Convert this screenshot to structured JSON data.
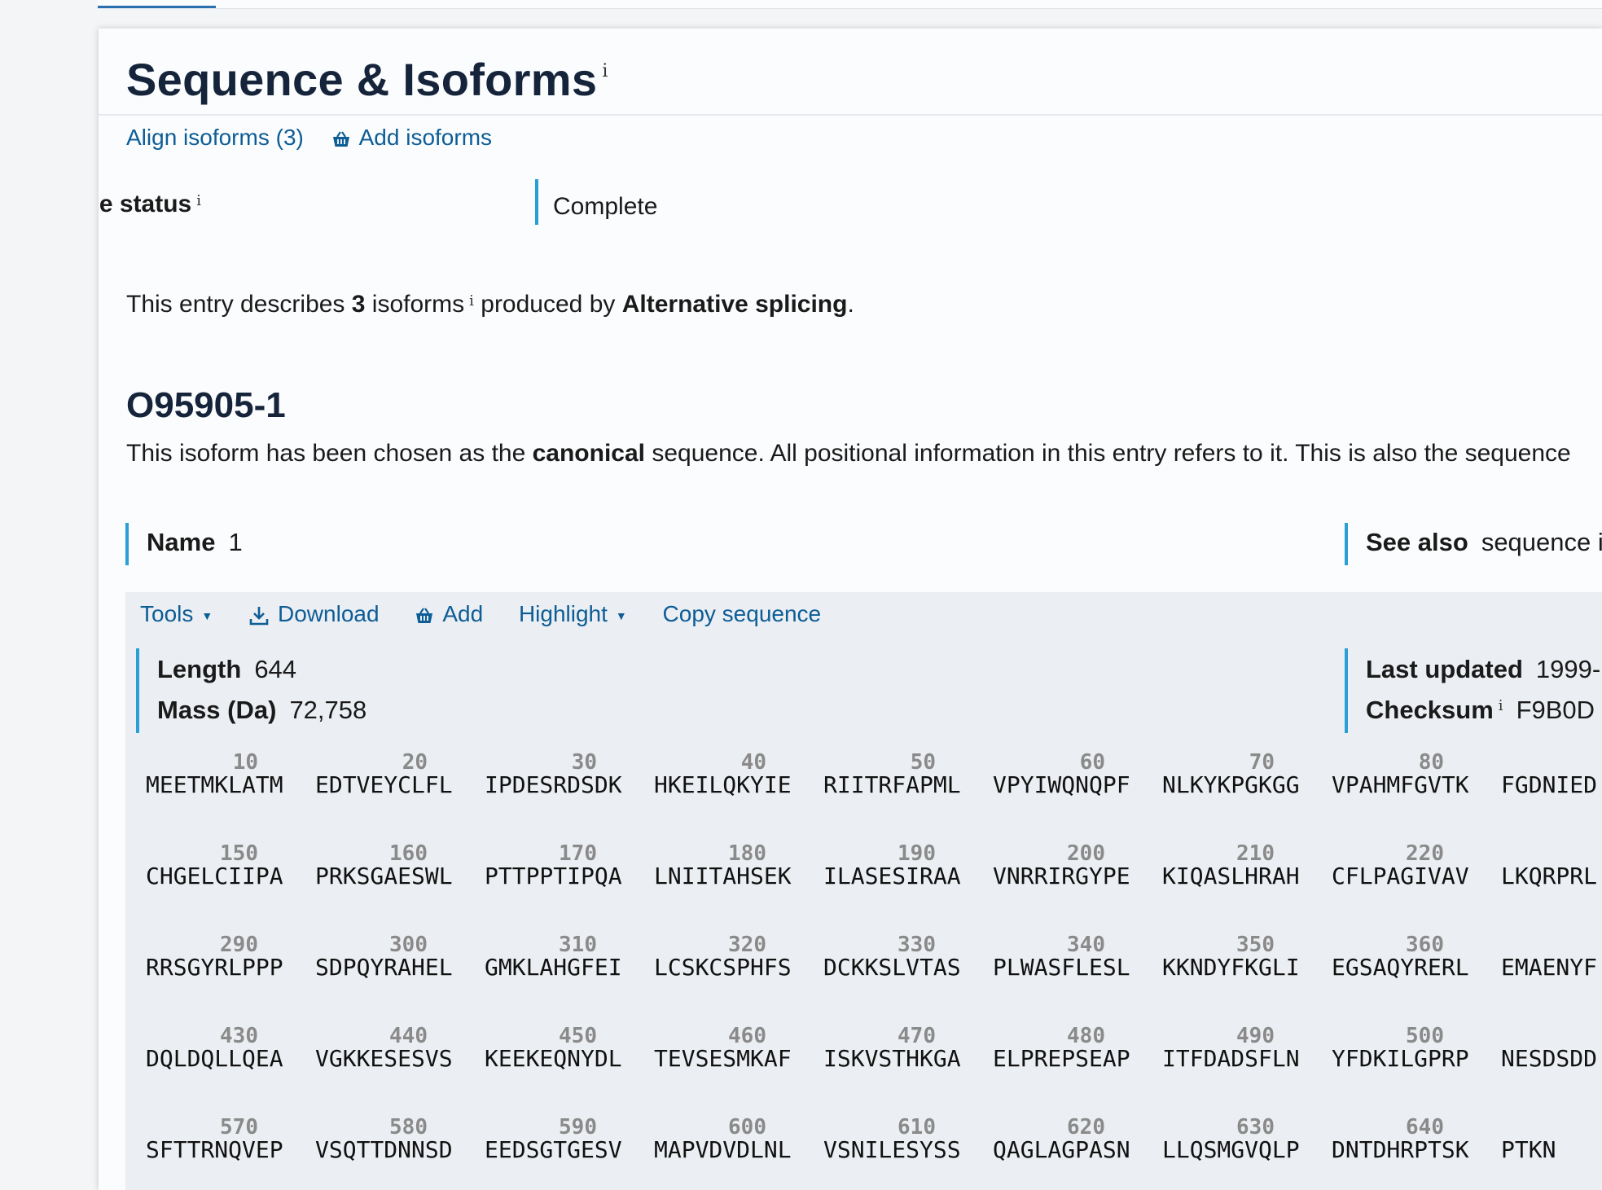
{
  "section": {
    "title": "Sequence & Isoforms",
    "info_marker": "i"
  },
  "links": {
    "align_isoforms": "Align isoforms (3)",
    "add_isoforms": "Add isoforms"
  },
  "sequence_status": {
    "label": "Sequence status",
    "value": "Complete"
  },
  "description": {
    "prefix": "This entry describes ",
    "count": "3",
    "middle": " isoforms",
    "after": " produced by ",
    "mechanism": "Alternative splicing",
    "end": "."
  },
  "isoform": {
    "id": "O95905-1",
    "text_prefix": "This isoform has been chosen as the ",
    "text_bold": "canonical",
    "text_suffix": " sequence. All positional information in this entry refers to it. This is also the sequence",
    "name_label": "Name",
    "name_value": "1",
    "see_also_label": "See also",
    "see_also_value": "sequence i"
  },
  "toolbar": {
    "tools": "Tools",
    "download": "Download",
    "add": "Add",
    "highlight": "Highlight",
    "copy_sequence": "Copy sequence"
  },
  "meta": {
    "length_label": "Length",
    "length_value": "644",
    "mass_label": "Mass (Da)",
    "mass_value": "72,758",
    "last_updated_label": "Last updated",
    "last_updated_value": "1999-",
    "checksum_label": "Checksum",
    "checksum_value": "F9B0D"
  },
  "sequence_rows": [
    [
      {
        "pos": "10",
        "res": "MEETMKLATM"
      },
      {
        "pos": "20",
        "res": "EDTVEYCLFL"
      },
      {
        "pos": "30",
        "res": "IPDESRDSDK"
      },
      {
        "pos": "40",
        "res": "HKEILQKYIE"
      },
      {
        "pos": "50",
        "res": "RIITRFAPML"
      },
      {
        "pos": "60",
        "res": "VPYIWQNQPF"
      },
      {
        "pos": "70",
        "res": "NLKYKPGKGG"
      },
      {
        "pos": "80",
        "res": "VPAHMFGVTK"
      },
      {
        "pos": "",
        "res": "FGDNIED"
      }
    ],
    [
      {
        "pos": "150",
        "res": "CHGELCIIPA"
      },
      {
        "pos": "160",
        "res": "PRKSGAESWL"
      },
      {
        "pos": "170",
        "res": "PTTPPTIPQA"
      },
      {
        "pos": "180",
        "res": "LNIITAHSEK"
      },
      {
        "pos": "190",
        "res": "ILASESIRAA"
      },
      {
        "pos": "200",
        "res": "VNRRIRGYPE"
      },
      {
        "pos": "210",
        "res": "KIQASLHRAH"
      },
      {
        "pos": "220",
        "res": "CFLPAGIVAV"
      },
      {
        "pos": "",
        "res": "LKQRPRL"
      }
    ],
    [
      {
        "pos": "290",
        "res": "RRSGYRLPPP"
      },
      {
        "pos": "300",
        "res": "SDPQYRAHEL"
      },
      {
        "pos": "310",
        "res": "GMKLAHGFEI"
      },
      {
        "pos": "320",
        "res": "LCSKCSPHFS"
      },
      {
        "pos": "330",
        "res": "DCKKSLVTAS"
      },
      {
        "pos": "340",
        "res": "PLWASFLESL"
      },
      {
        "pos": "350",
        "res": "KKNDYFKGLI"
      },
      {
        "pos": "360",
        "res": "EGSAQYRERL"
      },
      {
        "pos": "",
        "res": "EMAENYF"
      }
    ],
    [
      {
        "pos": "430",
        "res": "DQLDQLLQEA"
      },
      {
        "pos": "440",
        "res": "VGKKESESVS"
      },
      {
        "pos": "450",
        "res": "KEEKEQNYDL"
      },
      {
        "pos": "460",
        "res": "TEVSESMKAF"
      },
      {
        "pos": "470",
        "res": "ISKVSTHKGA"
      },
      {
        "pos": "480",
        "res": "ELPREPSEAP"
      },
      {
        "pos": "490",
        "res": "ITFDADSFLN"
      },
      {
        "pos": "500",
        "res": "YFDKILGPRP"
      },
      {
        "pos": "",
        "res": "NESDSDD"
      }
    ],
    [
      {
        "pos": "570",
        "res": "SFTTRNQVEP"
      },
      {
        "pos": "580",
        "res": "VSQTTDNNSD"
      },
      {
        "pos": "590",
        "res": "EEDSGTGESV"
      },
      {
        "pos": "600",
        "res": "MAPVDVDLNL"
      },
      {
        "pos": "610",
        "res": "VSNILESYSS"
      },
      {
        "pos": "620",
        "res": "QAGLAGPASN"
      },
      {
        "pos": "630",
        "res": "LLQSMGVQLP"
      },
      {
        "pos": "640",
        "res": "DNTDHRPTSK"
      },
      {
        "pos": "",
        "res": "PTKN"
      }
    ]
  ]
}
